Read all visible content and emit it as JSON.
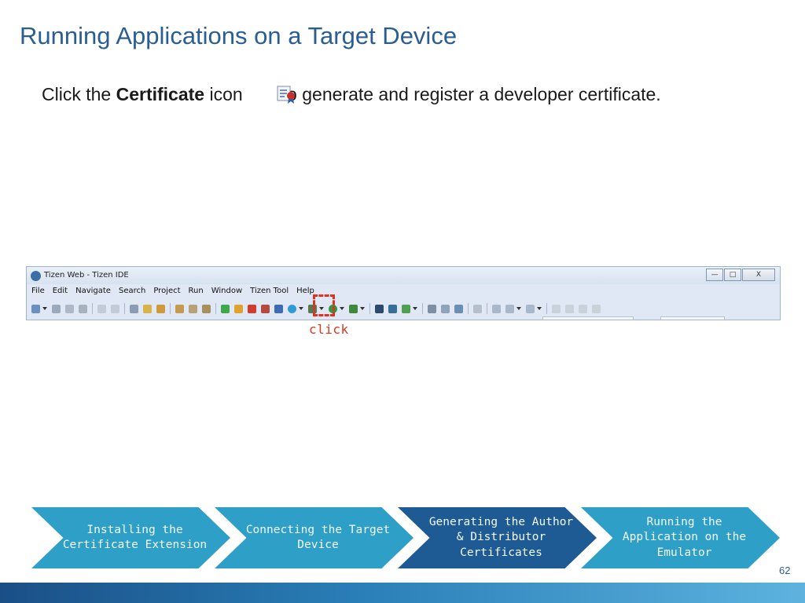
{
  "slide": {
    "title": "Running Applications on a Target Device",
    "instruction_prefix": "Click the ",
    "instruction_bold": "Certificate",
    "instruction_mid": " icon",
    "instruction_suffix": "to generate and register a developer certificate.",
    "certificate_icon": "certificate-icon",
    "page_number": "62"
  },
  "ide": {
    "window_title": "Tizen Web - Tizen IDE",
    "window_buttons": {
      "minimize": "—",
      "maximize": "□",
      "close": "X"
    },
    "menu": [
      "File",
      "Edit",
      "Navigate",
      "Search",
      "Project",
      "Run",
      "Window",
      "Tizen Tool",
      "Help"
    ],
    "click_label": "click"
  },
  "process": {
    "steps": [
      "Installing the Certificate Extension",
      "Connecting the Target Device",
      "Generating the Author & Distributor Certificates",
      "Running the Application on the Emulator"
    ],
    "active_step": "Generating the Author & Distributor Certificates"
  },
  "colors": {
    "title": "#2a5e93",
    "step": "#2ea0c7",
    "step_active": "#1e5a94",
    "highlight": "#e0321e"
  }
}
